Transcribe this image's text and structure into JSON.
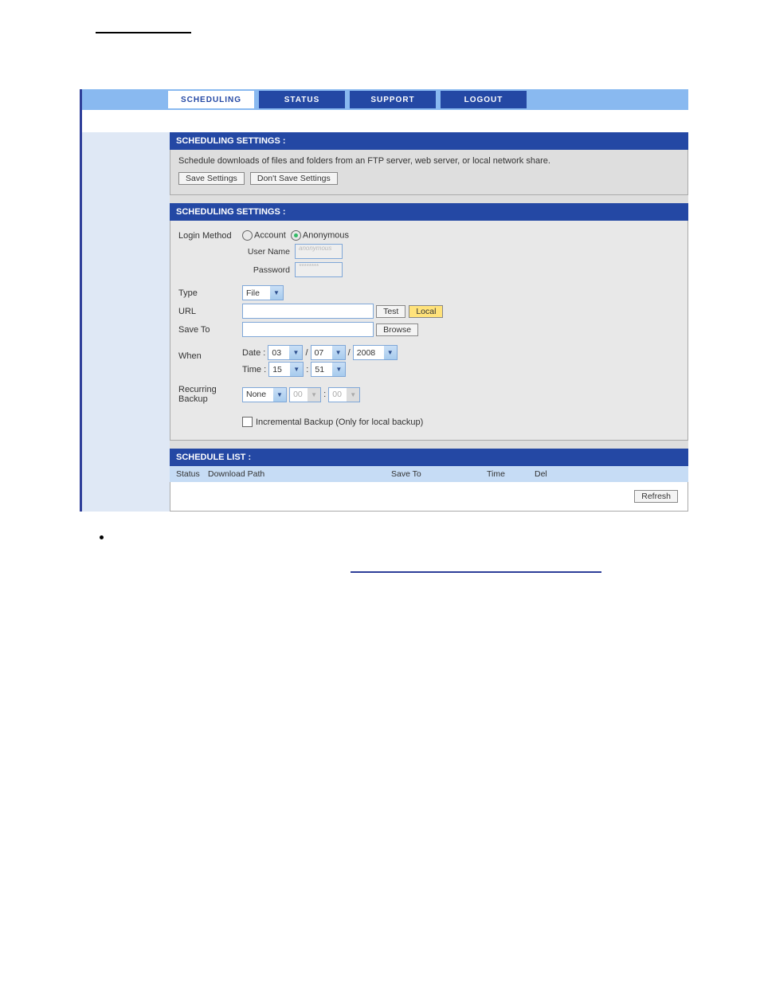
{
  "nav": {
    "items": [
      {
        "label": "SCHEDULING",
        "active": true
      },
      {
        "label": "STATUS"
      },
      {
        "label": "SUPPORT"
      },
      {
        "label": "LOGOUT"
      }
    ]
  },
  "intro_panel": {
    "title": "SCHEDULING SETTINGS :",
    "desc": "Schedule downloads of files and folders from an FTP server, web server, or local network share.",
    "save_btn": "Save Settings",
    "dont_save_btn": "Don't Save Settings"
  },
  "settings_panel": {
    "title": "SCHEDULING SETTINGS :",
    "login_method_label": "Login Method",
    "account_label": "Account",
    "anonymous_label": "Anonymous",
    "username_label": "User Name",
    "username_value": "anonymous",
    "password_label": "Password",
    "password_value": "********",
    "type_label": "Type",
    "type_value": "File",
    "url_label": "URL",
    "url_value": "",
    "test_btn": "Test",
    "local_btn": "Local",
    "saveto_label": "Save To",
    "saveto_value": "",
    "browse_btn": "Browse",
    "when_label": "When",
    "date_label": "Date :",
    "date_mm": "03",
    "date_dd": "07",
    "date_yyyy": "2008",
    "time_label": "Time :",
    "time_hh": "15",
    "time_mm": "51",
    "recurring_label": "Recurring Backup",
    "recurring_value": "None",
    "recurring_hh": "00",
    "recurring_mm": "00",
    "incremental_label": "Incremental Backup (Only for local backup)"
  },
  "schedule_list": {
    "title": "SCHEDULE LIST :",
    "col_status": "Status",
    "col_download_path": "Download Path",
    "col_save_to": "Save To",
    "col_time": "Time",
    "col_del": "Del",
    "refresh_btn": "Refresh"
  }
}
